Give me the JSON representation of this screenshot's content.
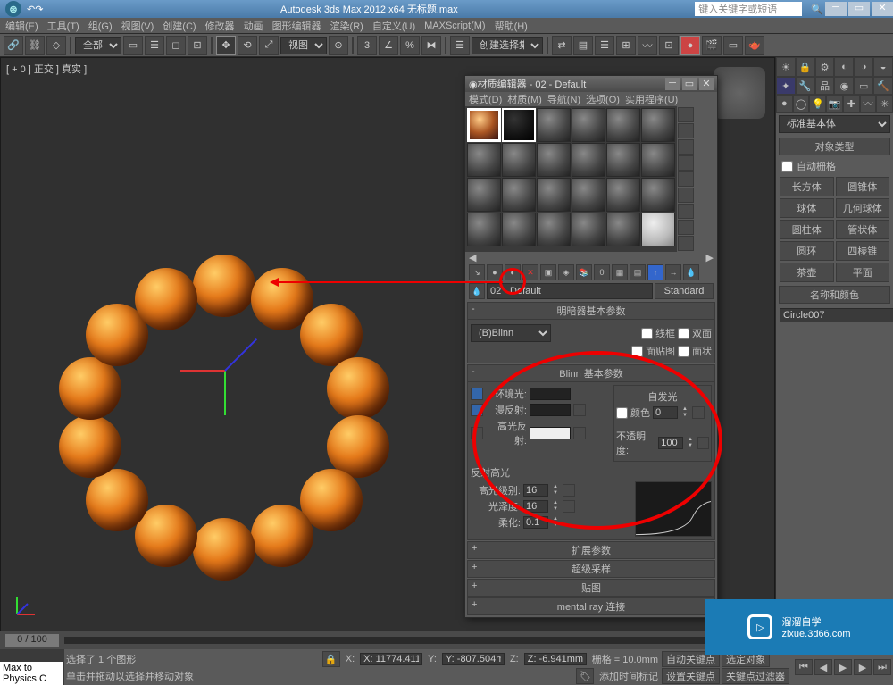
{
  "titlebar": {
    "title": "Autodesk 3ds Max  2012 x64  无标题.max",
    "search_placeholder": "键入关键字或短语"
  },
  "menubar": [
    "编辑(E)",
    "工具(T)",
    "组(G)",
    "视图(V)",
    "创建(C)",
    "修改器",
    "动画",
    "图形编辑器",
    "渲染(R)",
    "自定义(U)",
    "MAXScript(M)",
    "帮助(H)"
  ],
  "toolbar": {
    "all": "全部",
    "view": "视图",
    "create_sel": "创建选择集"
  },
  "viewport": {
    "label": "[ + 0 ] 正交 ] 真实 ]"
  },
  "cmdpanel": {
    "dropdown": "标准基本体",
    "obj_type_hdr": "对象类型",
    "auto_grid": "自动栅格",
    "objs": [
      "长方体",
      "圆锥体",
      "球体",
      "几何球体",
      "圆柱体",
      "管状体",
      "圆环",
      "四棱锥",
      "茶壶",
      "平面"
    ],
    "name_hdr": "名称和颜色",
    "name_val": "Circle007"
  },
  "mateditor": {
    "title": "材质编辑器 - 02 - Default",
    "menu": [
      "模式(D)",
      "材质(M)",
      "导航(N)",
      "选项(O)",
      "实用程序(U)"
    ],
    "mat_name": "02 - Default",
    "std_btn": "Standard",
    "shader_hdr": "明暗器基本参数",
    "shader_sel": "(B)Blinn",
    "wire": "线框",
    "twoSided": "双面",
    "faceMap": "面贴图",
    "faceted": "面状",
    "blinn_hdr": "Blinn 基本参数",
    "self_illum": "自发光",
    "color_lbl": "颜色",
    "color_val": "0",
    "ambient": "环境光:",
    "diffuse": "漫反射:",
    "specular": "高光反射:",
    "opacity": "不透明度:",
    "opacity_val": "100",
    "spec_hdr": "反射高光",
    "spec_level": "高光级别:",
    "spec_level_val": "16",
    "gloss": "光泽度:",
    "gloss_val": "16",
    "soften": "柔化:",
    "soften_val": "0.1",
    "ext_hdr": "扩展参数",
    "super_hdr": "超级采样",
    "maps_hdr": "贴图",
    "mr_hdr": "mental ray 连接"
  },
  "timeline": {
    "pos": "0 / 100"
  },
  "status": {
    "script": "Max to Physics C",
    "sel": "选择了 1 个图形",
    "hint": "单击并拖动以选择并移动对象",
    "add_tm": "添加时间标记",
    "x": "X: 11774.411r",
    "y": "Y: -807.504m",
    "z": "Z: -6.941mm",
    "grid": "栅格 = 10.0mm",
    "autokey": "自动关键点",
    "selset": "选定对象",
    "setkey": "设置关键点",
    "keyfilter": "关键点过滤器"
  },
  "watermark": {
    "brand": "溜溜自学",
    "url": "zixue.3d66.com"
  }
}
